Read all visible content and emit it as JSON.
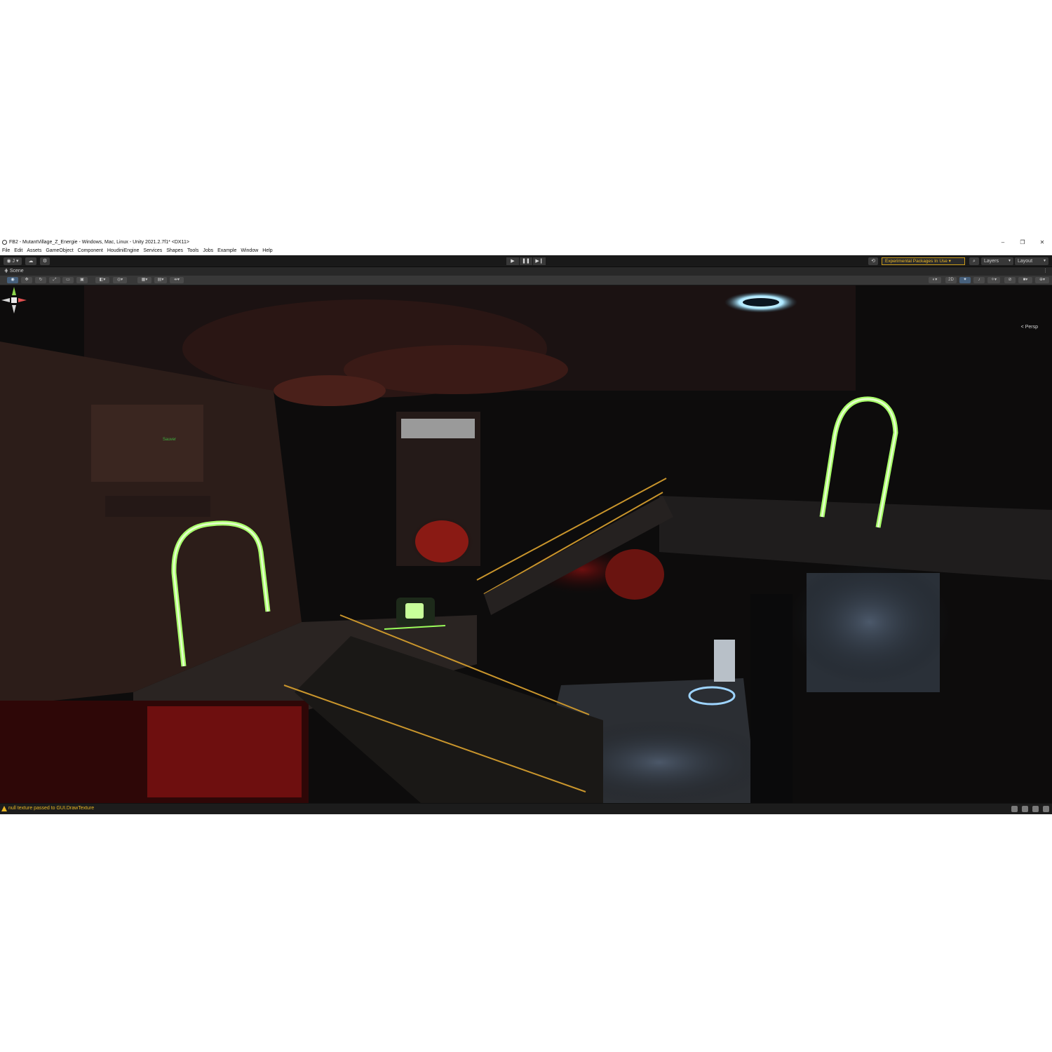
{
  "window": {
    "title": "FB2 - MutantVillage_Z_Energie - Windows, Mac, Linux - Unity 2021.2.7f1* <DX11>",
    "controls": {
      "minimize": "–",
      "maximize": "❐",
      "close": "✕"
    }
  },
  "menu": [
    "File",
    "Edit",
    "Assets",
    "GameObject",
    "Component",
    "HoudiniEngine",
    "Services",
    "Shapes",
    "Tools",
    "Jobs",
    "Example",
    "Window",
    "Help"
  ],
  "toolbar": {
    "account": "J",
    "play": "▶",
    "pause": "❚❚",
    "step": "▶❙",
    "experimental_packages": "Experimental Packages In Use ▾",
    "layers": "Layers",
    "layout": "Layout"
  },
  "scene_tab": {
    "label": "Scene",
    "more": "⋮"
  },
  "scene_toolbar": {
    "mode_2d": "2D"
  },
  "viewport": {
    "projection": "< Persp",
    "sign_text": "Sauver"
  },
  "status": {
    "message": "null texture passed to GUI.DrawTexture",
    "color": "#e8b524"
  }
}
